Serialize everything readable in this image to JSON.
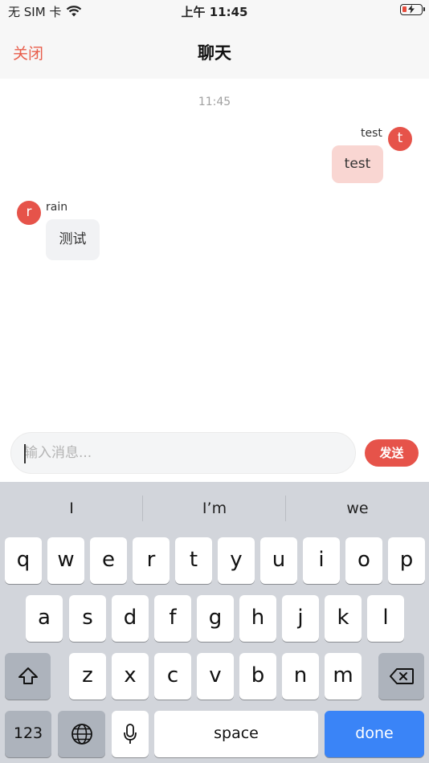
{
  "status_bar": {
    "carrier": "无 SIM 卡",
    "time": "上午 11:45",
    "wifi_icon": "wifi-icon",
    "battery_icon": "battery-charging-icon"
  },
  "nav": {
    "close_label": "关闭",
    "title": "聊天"
  },
  "chat": {
    "timestamp": "11:45",
    "messages": [
      {
        "sender": "test",
        "avatar": "t",
        "text": "test",
        "side": "right"
      },
      {
        "sender": "rain",
        "avatar": "r",
        "text": "测试",
        "side": "left"
      }
    ]
  },
  "composer": {
    "placeholder": "输入消息...",
    "send_label": "发送"
  },
  "keyboard": {
    "suggestions": [
      "I",
      "I’m",
      "we"
    ],
    "row1": [
      "q",
      "w",
      "e",
      "r",
      "t",
      "y",
      "u",
      "i",
      "o",
      "p"
    ],
    "row2": [
      "a",
      "s",
      "d",
      "f",
      "g",
      "h",
      "j",
      "k",
      "l"
    ],
    "row3": [
      "z",
      "x",
      "c",
      "v",
      "b",
      "n",
      "m"
    ],
    "numbers_label": "123",
    "space_label": "space",
    "done_label": "done"
  },
  "colors": {
    "accent": "#e6534a",
    "outgoing_bubble": "#f9d6d2",
    "incoming_bubble": "#f1f2f4",
    "done_key": "#3a84f7"
  }
}
